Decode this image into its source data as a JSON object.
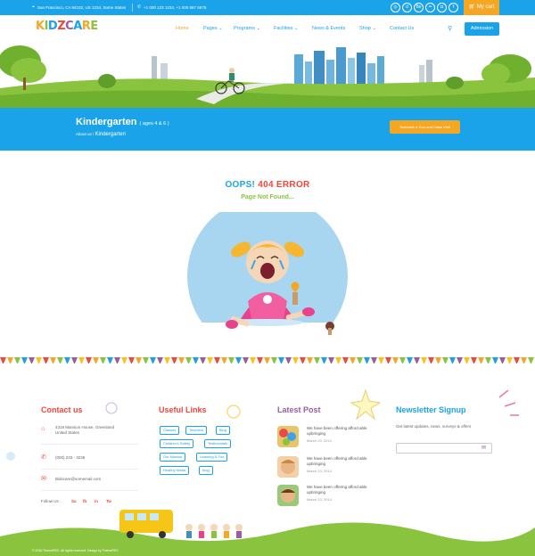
{
  "topbar": {
    "address": "San Francisco, CA 94102, US 1234, Some States",
    "phone": "+1 000 123 1234, +1 000 567 5678",
    "social_icons": [
      "tripadvisor-icon",
      "digg-icon",
      "behance-icon",
      "flickr-icon",
      "instagram-icon",
      "facebook-icon"
    ],
    "cart_label": "My cart"
  },
  "header": {
    "logo_text": "KIDZCARE",
    "nav": [
      {
        "label": "Home",
        "active": true
      },
      {
        "label": "Pages",
        "caret": "⌄"
      },
      {
        "label": "Programs",
        "caret": "⌄"
      },
      {
        "label": "Facilities",
        "caret": "⌄"
      },
      {
        "label": "News & Events"
      },
      {
        "label": "Shop",
        "caret": "⌄"
      },
      {
        "label": "Contact Us"
      }
    ],
    "admission_label": "Admission"
  },
  "banner": {
    "title": "Kindergarten",
    "subtitle": "( ages 4 & 6 )",
    "breadcrumb_parent": "About us",
    "breadcrumb_sep": " / ",
    "breadcrumb_current": "Kindergarten",
    "cta_label": "Schedule a Tour and Class Visit"
  },
  "error": {
    "oops": "OOPS!",
    "code": "404 ERROR",
    "message": "Page Not Found..."
  },
  "footer": {
    "contact": {
      "title": "Contact us",
      "address": "4318 Mansion House, Greenland United States",
      "phone": "(000) 233 - 3236",
      "email": "Bidscare@somemail.com",
      "follow_label": "Follow Us :",
      "social": [
        "Sa",
        "fb",
        "in",
        "Tw"
      ]
    },
    "links": {
      "title": "Useful Links",
      "tags": [
        "Classes",
        "Teachers",
        "Blog",
        "Children's Safety",
        "Testimonials",
        "Our Mission",
        "Learning & Fun",
        "Healthy Meals",
        "blog"
      ]
    },
    "latest": {
      "title": "Latest Post",
      "posts": [
        {
          "text": "We have been offering afford able upbringing",
          "date": "March 23, 2014"
        },
        {
          "text": "We have been offering afford able upbringing",
          "date": "March 23, 2014"
        },
        {
          "text": "We have been offering afford able upbringing",
          "date": "March 23, 2014"
        }
      ]
    },
    "newsletter": {
      "title": "Newsletter Signup",
      "desc": "Get latest updates, news, surveys & offers",
      "placeholder": ""
    },
    "copyright": "© 2016 ThemeREX. All rights reserved. Design by ThemeREX"
  },
  "colors": {
    "blue": "#1aa3e8",
    "orange": "#f5a623",
    "red": "#f2463a",
    "green": "#8ac43f",
    "purple": "#9b5ba5"
  }
}
